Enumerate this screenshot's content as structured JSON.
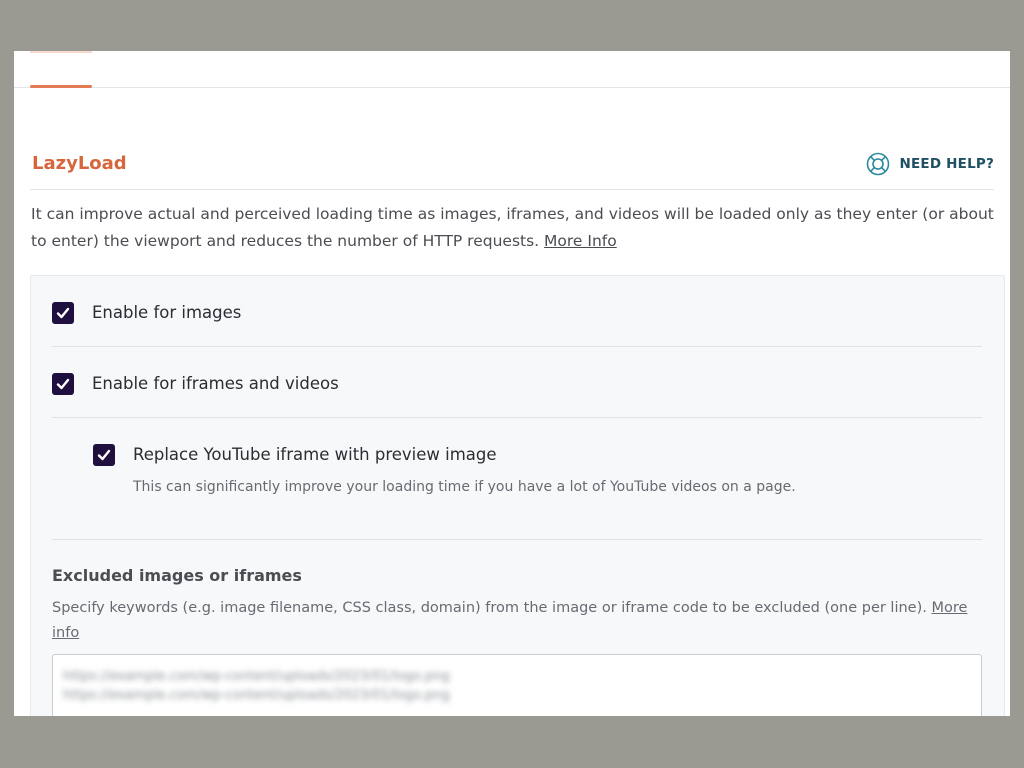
{
  "section": {
    "title": "LazyLoad",
    "help_label": "NEED HELP?",
    "description": "It can improve actual and perceived loading time as images, iframes, and videos will be loaded only as they enter (or about to enter) the viewport and reduces the number of HTTP requests.",
    "description_link": "More Info"
  },
  "options": [
    {
      "label": "Enable for images",
      "checked": true
    },
    {
      "label": "Enable for iframes and videos",
      "checked": true
    },
    {
      "label": "Replace YouTube iframe with preview image",
      "checked": true,
      "help": "This can significantly improve your loading time if you have a lot of YouTube videos on a page."
    }
  ],
  "excluded": {
    "title": "Excluded images or iframes",
    "description": "Specify keywords (e.g. image filename, CSS class, domain) from the image or iframe code to be excluded (one per line).",
    "link": "More info",
    "value": "https://example.com/wp-content/uploads/2023/01/logo.png\nhttps://example.com/wp-content/uploads/2023/01/logo.png"
  },
  "colors": {
    "accent": "#d6673d",
    "checkbox": "#1f0f3f",
    "help": "#1e4f63",
    "backdrop": "#9a9a93"
  }
}
